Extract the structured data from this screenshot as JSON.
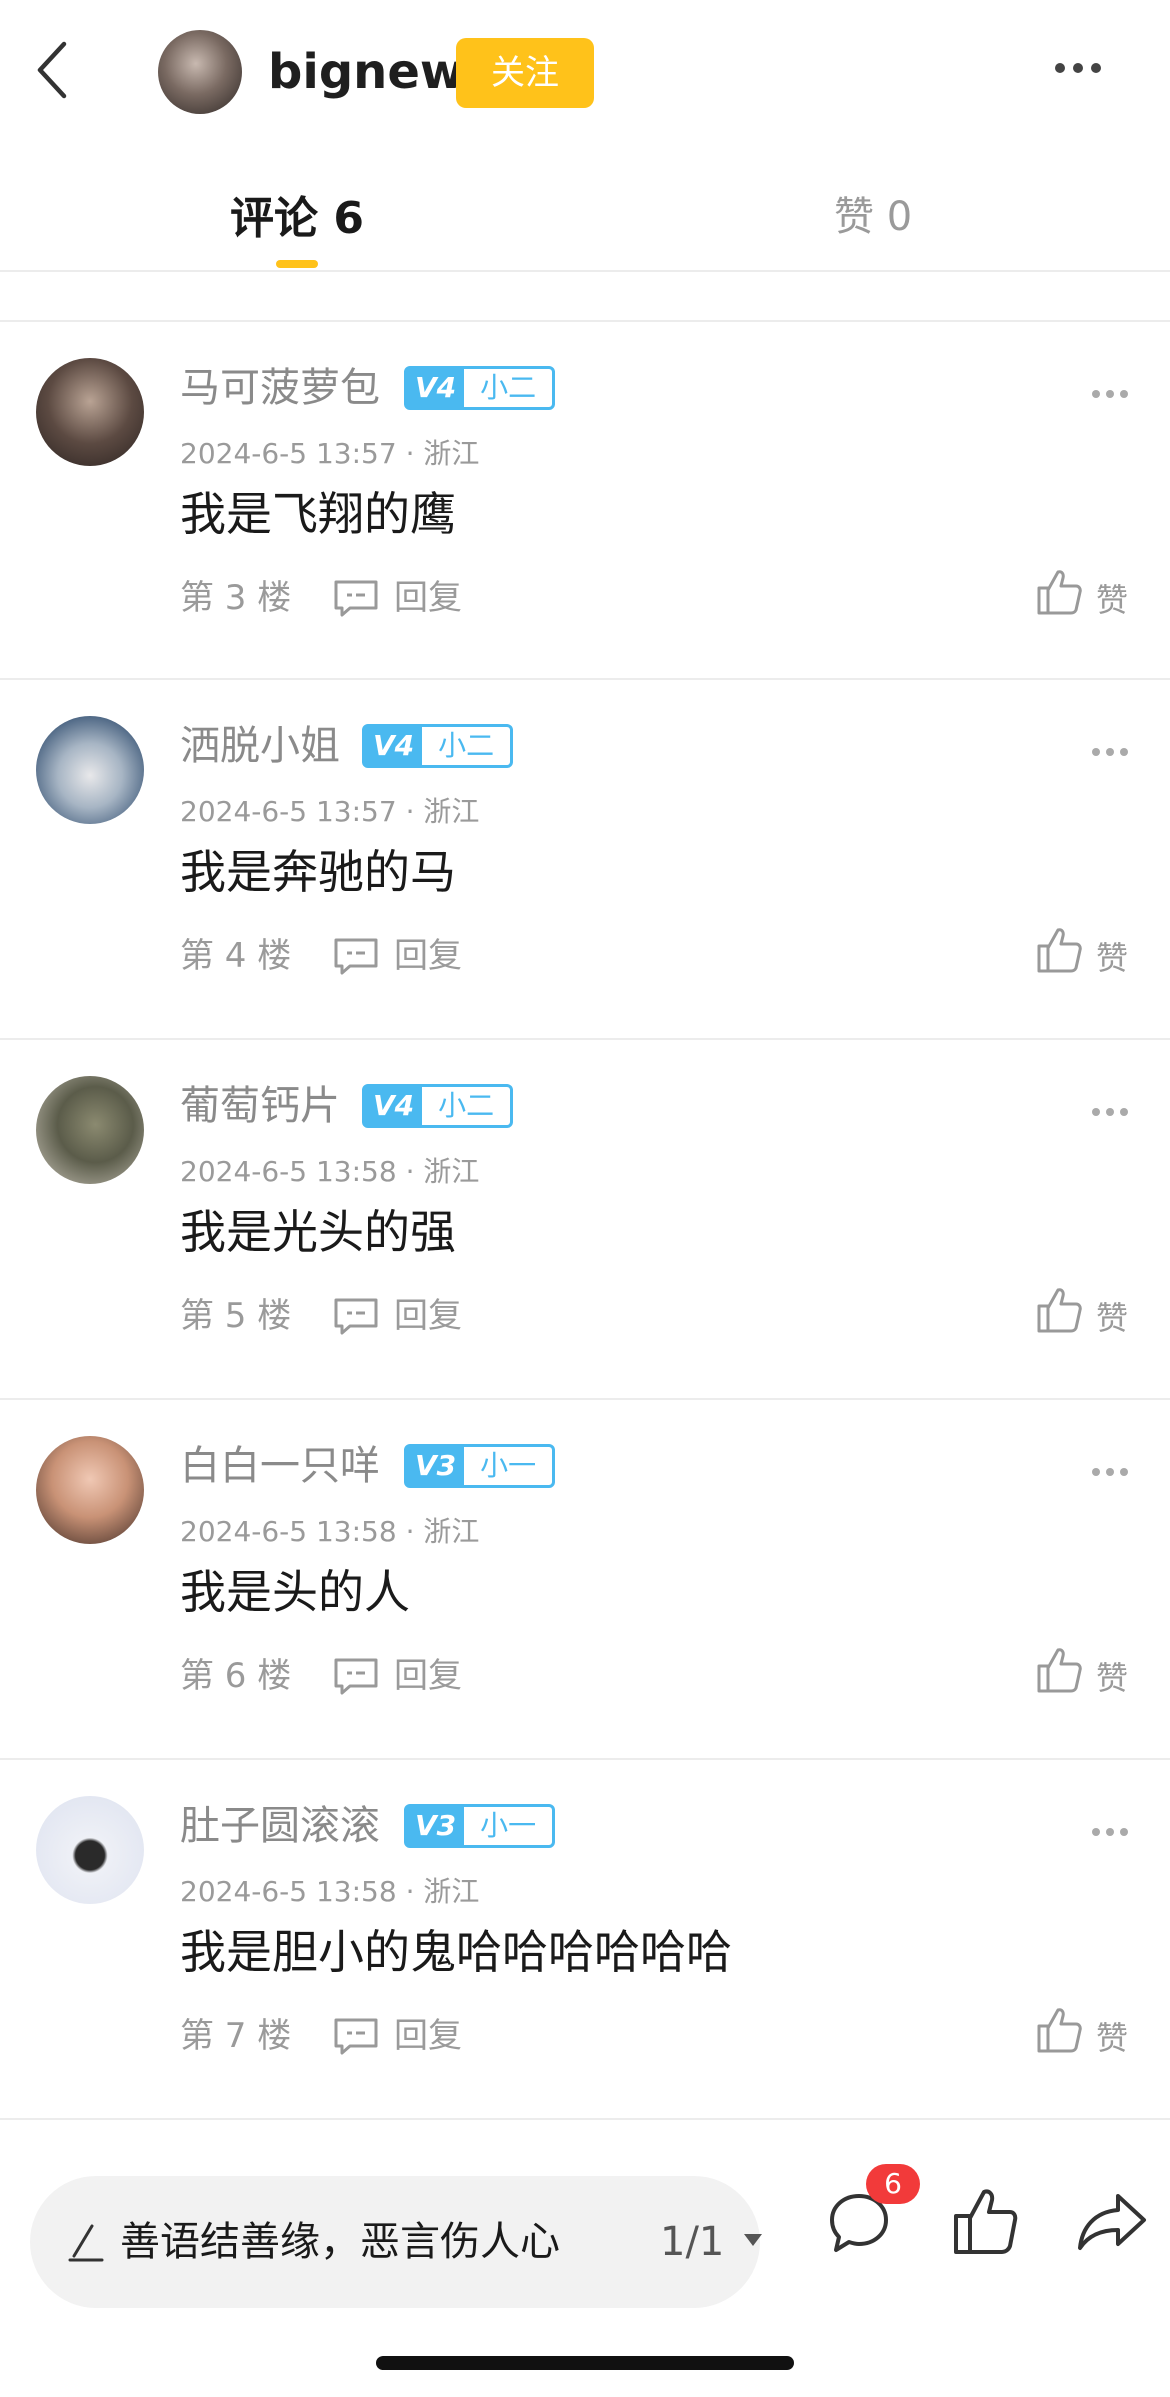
{
  "header": {
    "author_name": "bignew",
    "follow_label": "关注"
  },
  "tabs": {
    "comments_label": "评论 6",
    "likes_label": "赞 0"
  },
  "comments": [
    {
      "user": "马可菠萝包",
      "level": "V4",
      "rank": "小二",
      "meta": "2024-6-5 13:57 · 浙江",
      "text": "我是飞翔的鹰",
      "floor": "第 3 楼",
      "reply": "回复",
      "like": "赞"
    },
    {
      "user": "洒脱小姐",
      "level": "V4",
      "rank": "小二",
      "meta": "2024-6-5 13:57 · 浙江",
      "text": "我是奔驰的马",
      "floor": "第 4 楼",
      "reply": "回复",
      "like": "赞"
    },
    {
      "user": "葡萄钙片",
      "level": "V4",
      "rank": "小二",
      "meta": "2024-6-5 13:58 · 浙江",
      "text": "我是光头的强",
      "floor": "第 5 楼",
      "reply": "回复",
      "like": "赞"
    },
    {
      "user": "白白一只咩",
      "level": "V3",
      "rank": "小一",
      "meta": "2024-6-5 13:58 · 浙江",
      "text": "我是头的人",
      "floor": "第 6 楼",
      "reply": "回复",
      "like": "赞"
    },
    {
      "user": "肚子圆滚滚",
      "level": "V3",
      "rank": "小一",
      "meta": "2024-6-5 13:58 · 浙江",
      "text": "我是胆小的鬼哈哈哈哈哈哈",
      "floor": "第 7 楼",
      "reply": "回复",
      "like": "赞"
    }
  ],
  "bottom_bar": {
    "input_placeholder": "善语结善缘，恶言伤人心",
    "page_indicator": "1/1",
    "comment_count": "6"
  },
  "colors": {
    "accent_yellow": "#ffc21a",
    "level_blue": "#4ab9f0",
    "badge_red": "#f23a3a"
  },
  "icons": [
    "back-arrow-icon",
    "more-dots-icon",
    "reply-bubble-icon",
    "thumb-up-icon",
    "pen-icon",
    "comment-bubble-icon",
    "share-arrow-icon"
  ]
}
